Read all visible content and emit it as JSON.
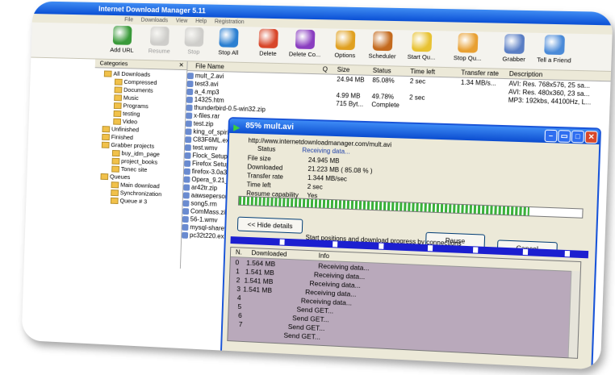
{
  "app": {
    "title": "Internet Download Manager 5.11",
    "menu": [
      "File",
      "Downloads",
      "View",
      "Help",
      "Registration"
    ]
  },
  "toolbar": {
    "items": [
      {
        "label": "Add URL",
        "icon": "add-url-icon",
        "disabled": false,
        "color": "#3a9a3a"
      },
      {
        "label": "Resume",
        "icon": "resume-icon",
        "disabled": true,
        "color": "#888888"
      },
      {
        "label": "Stop",
        "icon": "stop-icon",
        "disabled": true,
        "color": "#888888"
      },
      {
        "label": "Stop All",
        "icon": "stop-all-icon",
        "disabled": false,
        "color": "#2b7fd1"
      },
      {
        "label": "Delete",
        "icon": "delete-icon",
        "disabled": false,
        "color": "#d8472a"
      },
      {
        "label": "Delete Co...",
        "icon": "delete-completed-icon",
        "disabled": false,
        "color": "#8a3ec0"
      },
      {
        "label": "Options",
        "icon": "options-icon",
        "disabled": false,
        "color": "#e0a020"
      },
      {
        "label": "Scheduler",
        "icon": "scheduler-icon",
        "disabled": false,
        "color": "#c46a1e"
      },
      {
        "label": "Start Qu...",
        "icon": "start-queue-icon",
        "disabled": false,
        "color": "#e8c232"
      },
      {
        "label": "Stop Qu...",
        "icon": "stop-queue-icon",
        "disabled": false,
        "color": "#e8a032"
      },
      {
        "label": "Grabber",
        "icon": "grabber-icon",
        "disabled": false,
        "color": "#5a7ec4"
      },
      {
        "label": "Tell a Friend",
        "icon": "tell-a-friend-icon",
        "disabled": false,
        "color": "#4a8ad8"
      }
    ]
  },
  "categories": {
    "header": "Categories",
    "nodes": [
      {
        "label": "All Downloads",
        "level": 1
      },
      {
        "label": "Compressed",
        "level": 2
      },
      {
        "label": "Documents",
        "level": 2
      },
      {
        "label": "Music",
        "level": 2
      },
      {
        "label": "Programs",
        "level": 2
      },
      {
        "label": "testing",
        "level": 2
      },
      {
        "label": "Video",
        "level": 2
      },
      {
        "label": "Unfinished",
        "level": 1
      },
      {
        "label": "Finished",
        "level": 1
      },
      {
        "label": "Grabber projects",
        "level": 1
      },
      {
        "label": "buy_idm_page",
        "level": 2
      },
      {
        "label": "project_books",
        "level": 2
      },
      {
        "label": "Tonec site",
        "level": 2
      },
      {
        "label": "Queues",
        "level": 1
      },
      {
        "label": "Main download",
        "level": 2
      },
      {
        "label": "Synchronization",
        "level": 2
      },
      {
        "label": "Queue # 3",
        "level": 2
      }
    ]
  },
  "file_list": {
    "columns": [
      "File Name",
      "Q",
      "Size",
      "Status",
      "Time left",
      "Transfer rate",
      "Description"
    ],
    "rows": [
      {
        "name": "mult_2.avi",
        "size": "24.94 MB",
        "status": "85.08%",
        "time": "2 sec",
        "rate": "1.34 MB/s...",
        "desc": "AVI: Res. 768x576, 25 sa..."
      },
      {
        "name": "test3.avi",
        "size": "",
        "status": "",
        "time": "",
        "rate": "",
        "desc": "AVI: Res. 480x360, 23 sa..."
      },
      {
        "name": "a_4.mp3",
        "size": "4.99 MB",
        "status": "49.78%",
        "time": "2 sec",
        "rate": "",
        "desc": "MP3: 192kbs, 44100Hz, L..."
      },
      {
        "name": "14325.htm",
        "size": "715 Byt...",
        "status": "Complete",
        "time": "",
        "rate": "",
        "desc": ""
      },
      {
        "name": "thunderbird-0.5-win32.zip",
        "size": "",
        "status": "",
        "time": "",
        "rate": "",
        "desc": ""
      },
      {
        "name": "x-files.rar",
        "size": "",
        "status": "",
        "time": "",
        "rate": "",
        "desc": ""
      },
      {
        "name": "test.zip",
        "size": "",
        "status": "",
        "time": "",
        "rate": "",
        "desc": ""
      },
      {
        "name": "king_of_spirit.rar",
        "size": "",
        "status": "",
        "time": "",
        "rate": "",
        "desc": ""
      },
      {
        "name": "C83F6ML.exe",
        "size": "",
        "status": "",
        "time": "",
        "rate": "",
        "desc": ""
      },
      {
        "name": "test.wmv",
        "size": "",
        "status": "",
        "time": "",
        "rate": "",
        "desc": ""
      },
      {
        "name": "Flock_Setup_0.4.8.exe",
        "size": "",
        "status": "",
        "time": "",
        "rate": "",
        "desc": ""
      },
      {
        "name": "Firefox Setup 2.0 Beta 2",
        "size": "",
        "status": "",
        "time": "",
        "rate": "",
        "desc": ""
      },
      {
        "name": "firefox-3.0a3pre.en-US.w",
        "size": "",
        "status": "",
        "time": "",
        "rate": "",
        "desc": ""
      },
      {
        "name": "Opera_9.21_Eng_Setup",
        "size": "",
        "status": "",
        "time": "",
        "rate": "",
        "desc": ""
      },
      {
        "name": "ar42tr.zip",
        "size": "",
        "status": "",
        "time": "",
        "rate": "",
        "desc": ""
      },
      {
        "name": "aawsepersonal.exe",
        "size": "",
        "status": "",
        "time": "",
        "rate": "",
        "desc": ""
      },
      {
        "name": "song5.rm",
        "size": "",
        "status": "",
        "time": "",
        "rate": "",
        "desc": ""
      },
      {
        "name": "ComMass.zip",
        "size": "",
        "status": "",
        "time": "",
        "rate": "",
        "desc": ""
      },
      {
        "name": "56-1.wmv",
        "size": "",
        "status": "",
        "time": "",
        "rate": "",
        "desc": ""
      },
      {
        "name": "mysql-shareware-win32-1",
        "size": "",
        "status": "",
        "time": "",
        "rate": "",
        "desc": ""
      },
      {
        "name": "pc32t220.exe",
        "size": "",
        "status": "",
        "time": "",
        "rate": "",
        "desc": ""
      }
    ]
  },
  "dialog": {
    "title": "85% mult.avi",
    "url": "http://www.internetdownloadmanager.com/mult.avi",
    "fields": [
      {
        "label": "Status",
        "value": "Receiving data..."
      },
      {
        "label": "File size",
        "value": "24.945 MB"
      },
      {
        "label": "Downloaded",
        "value": "21.223 MB  ( 85.08 % )"
      },
      {
        "label": "Transfer rate",
        "value": "1.344 MB/sec"
      },
      {
        "label": "Time left",
        "value": "2 sec"
      },
      {
        "label": "Resume capability",
        "value": "Yes"
      }
    ],
    "progress": 0.85,
    "hide_details_label": "<< Hide details",
    "pause_label": "Pause",
    "cancel_label": "Cancel",
    "connections_caption": "Start positions and download progress by connections",
    "conn_columns": [
      "N.",
      "Downloaded",
      "Info"
    ],
    "connections": [
      {
        "n": "0",
        "downloaded": "1.564 MB",
        "info": "Receiving data..."
      },
      {
        "n": "1",
        "downloaded": "1.541 MB",
        "info": "Receiving data..."
      },
      {
        "n": "2",
        "downloaded": "1.541 MB",
        "info": "Receiving data..."
      },
      {
        "n": "3",
        "downloaded": "1.541 MB",
        "info": "Receiving data..."
      },
      {
        "n": "4",
        "downloaded": "",
        "info": "Receiving data..."
      },
      {
        "n": "5",
        "downloaded": "",
        "info": "Send GET..."
      },
      {
        "n": "6",
        "downloaded": "",
        "info": "Send GET..."
      },
      {
        "n": "7",
        "downloaded": "",
        "info": "Send GET..."
      },
      {
        "n": "",
        "downloaded": "",
        "info": "Send GET..."
      }
    ]
  }
}
